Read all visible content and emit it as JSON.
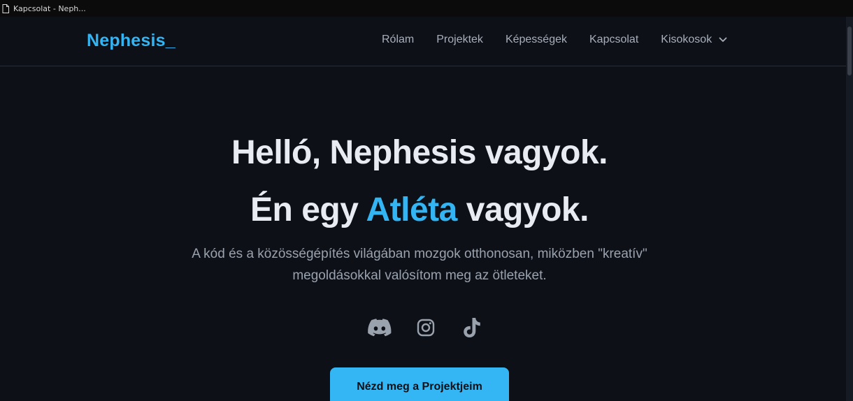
{
  "browser": {
    "tab_title": "Kapcsolat - Neph..."
  },
  "nav": {
    "logo": "Nephesis_",
    "items": [
      {
        "label": "Rólam"
      },
      {
        "label": "Projektek"
      },
      {
        "label": "Képességek"
      },
      {
        "label": "Kapcsolat"
      },
      {
        "label": "Kisokosok"
      }
    ]
  },
  "hero": {
    "line1": "Helló, Nephesis vagyok.",
    "line2_prefix": "Én egy",
    "line2_accent": "Atléta",
    "line2_suffix": "vagyok.",
    "subtitle_1": "A kód és a közösségépítés világában mozgok otthonosan, miközben \"kreatív\"",
    "subtitle_2": "megoldásokkal valósítom meg az ötleteket.",
    "socials": [
      "discord-icon",
      "instagram-icon",
      "tiktok-icon"
    ],
    "cta_label": "Nézd meg a Projektjeim"
  },
  "colors": {
    "background": "#0d1017",
    "accent": "#33b5f3",
    "text": "#e8ebf1",
    "muted": "#9aa2ae"
  }
}
